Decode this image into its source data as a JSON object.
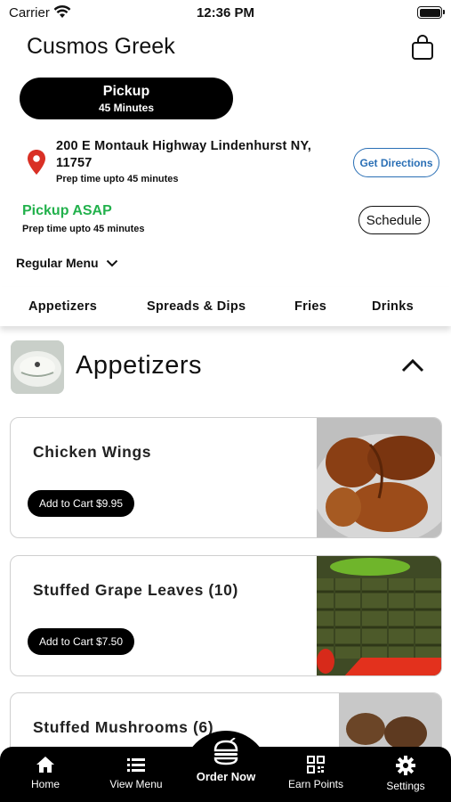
{
  "status_bar": {
    "carrier": "Carrier",
    "time": "12:36 PM"
  },
  "header": {
    "title": "Cusmos Greek"
  },
  "pickup": {
    "label": "Pickup",
    "duration": "45 Minutes"
  },
  "location": {
    "address": "200 E Montauk Highway Lindenhurst NY, 11757",
    "prep_time": "Prep time upto 45 minutes",
    "directions_label": "Get Directions"
  },
  "asap": {
    "label": "Pickup ASAP",
    "prep_time": "Prep time upto 45 minutes",
    "schedule_label": "Schedule"
  },
  "menu_select": {
    "value": "Regular Menu"
  },
  "tabs": [
    {
      "label": "Appetizers"
    },
    {
      "label": "Spreads & Dips"
    },
    {
      "label": "Fries"
    },
    {
      "label": "Drinks"
    }
  ],
  "section": {
    "title": "Appetizers"
  },
  "items": [
    {
      "name": "Chicken Wings",
      "cart_label": "Add to Cart $9.95"
    },
    {
      "name": "Stuffed Grape Leaves (10)",
      "cart_label": "Add to Cart $7.50"
    },
    {
      "name": "Stuffed Mushrooms (6)"
    }
  ],
  "bottom_nav": {
    "home": "Home",
    "view_menu": "View Menu",
    "order_now": "Order Now",
    "earn_points": "Earn Points",
    "settings": "Settings"
  },
  "colors": {
    "accent_green": "#22b14c",
    "link_blue": "#2a6fb5",
    "pin_red": "#d93025"
  },
  "icons": [
    "wifi-icon",
    "battery-icon",
    "shopping-bag-icon",
    "location-pin-icon",
    "chevron-down-icon",
    "chevron-up-icon",
    "home-icon",
    "list-icon",
    "burger-icon",
    "qr-code-icon",
    "gear-icon"
  ]
}
